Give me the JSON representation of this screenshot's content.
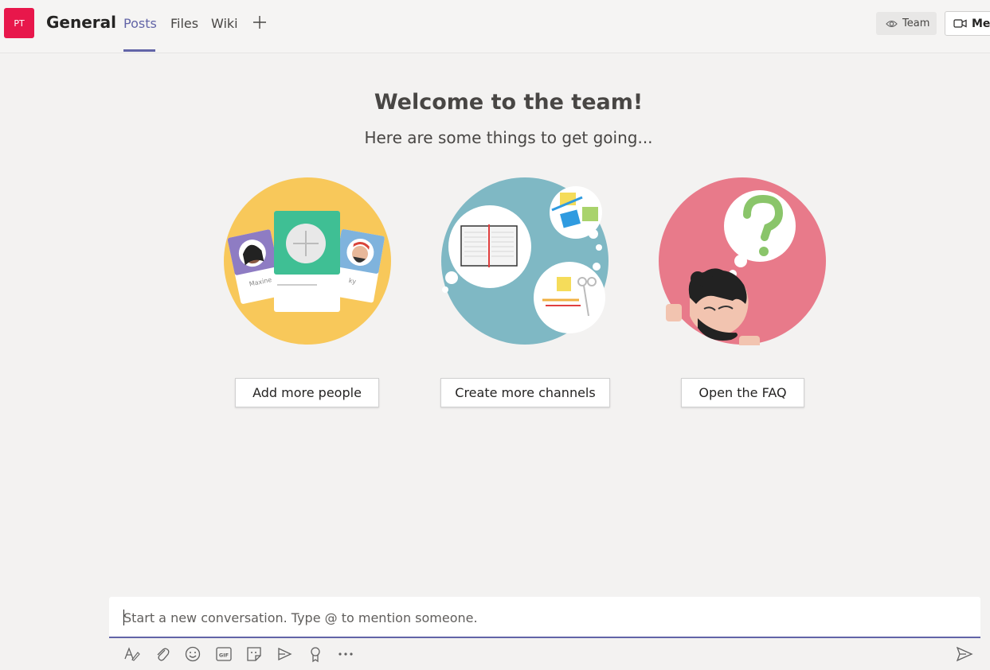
{
  "header": {
    "team_initials": "PT",
    "channel_name": "General",
    "tabs": [
      {
        "label": "Posts",
        "active": true
      },
      {
        "label": "Files",
        "active": false
      },
      {
        "label": "Wiki",
        "active": false
      }
    ],
    "team_button_label": "Team",
    "meet_button_label": "Mee"
  },
  "welcome": {
    "title": "Welcome to the team!",
    "subtitle": "Here are some things to get going...",
    "cards": [
      {
        "button_label": "Add more people",
        "illustration_text": [
          "Maxine",
          "ky"
        ]
      },
      {
        "button_label": "Create more channels"
      },
      {
        "button_label": "Open the FAQ"
      }
    ]
  },
  "compose": {
    "placeholder": "Start a new conversation. Type @ to mention someone."
  },
  "toolbar": {
    "gif_label": "GIF",
    "icons": [
      "format-icon",
      "attach-icon",
      "emoji-icon",
      "gif-icon",
      "sticker-icon",
      "meet-now-icon",
      "praise-icon",
      "more-options-icon",
      "send-icon"
    ]
  },
  "colors": {
    "accent": "#6264a7",
    "team_avatar": "#e8174b",
    "people_circle": "#f8c85a",
    "channels_circle": "#7fb8c4",
    "faq_circle": "#e87a8a"
  }
}
